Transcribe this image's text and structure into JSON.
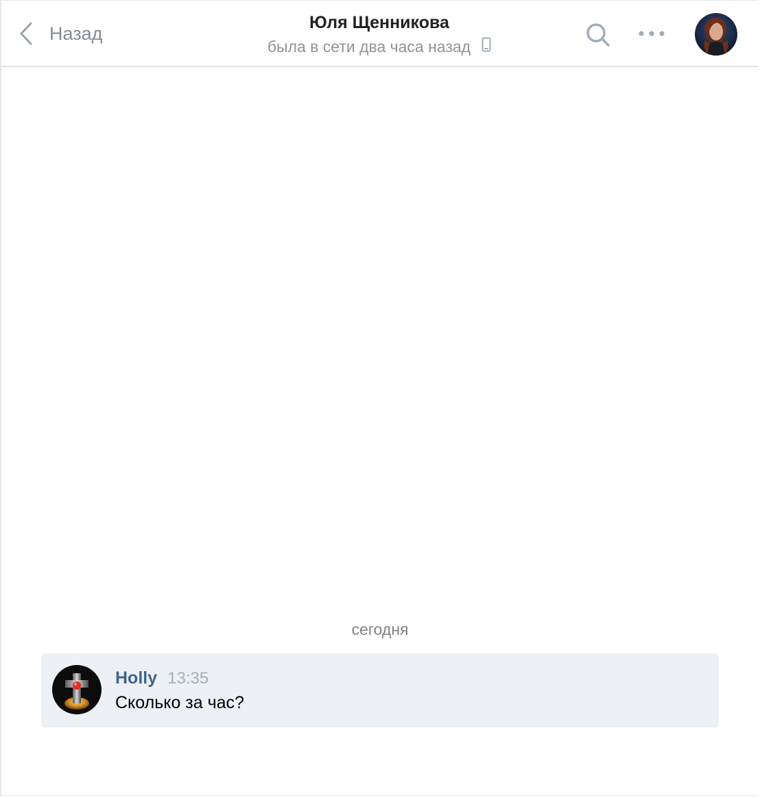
{
  "header": {
    "back_label": "Назад",
    "peer_name": "Юля Щенникова",
    "peer_status": "была в сети два часа назад",
    "status_device_icon": "mobile-phone-icon",
    "search_icon": "search-icon",
    "more_icon": "more-dots-icon",
    "avatar_icon": "peer-avatar"
  },
  "chat": {
    "date_separator": "сегодня",
    "messages": [
      {
        "author": "Holly",
        "time": "13:35",
        "text": "Сколько за час?",
        "avatar_icon": "author-avatar"
      }
    ]
  },
  "colors": {
    "accent_author": "#42648b",
    "message_bg": "#edf0f5",
    "muted_text": "#818c99"
  }
}
